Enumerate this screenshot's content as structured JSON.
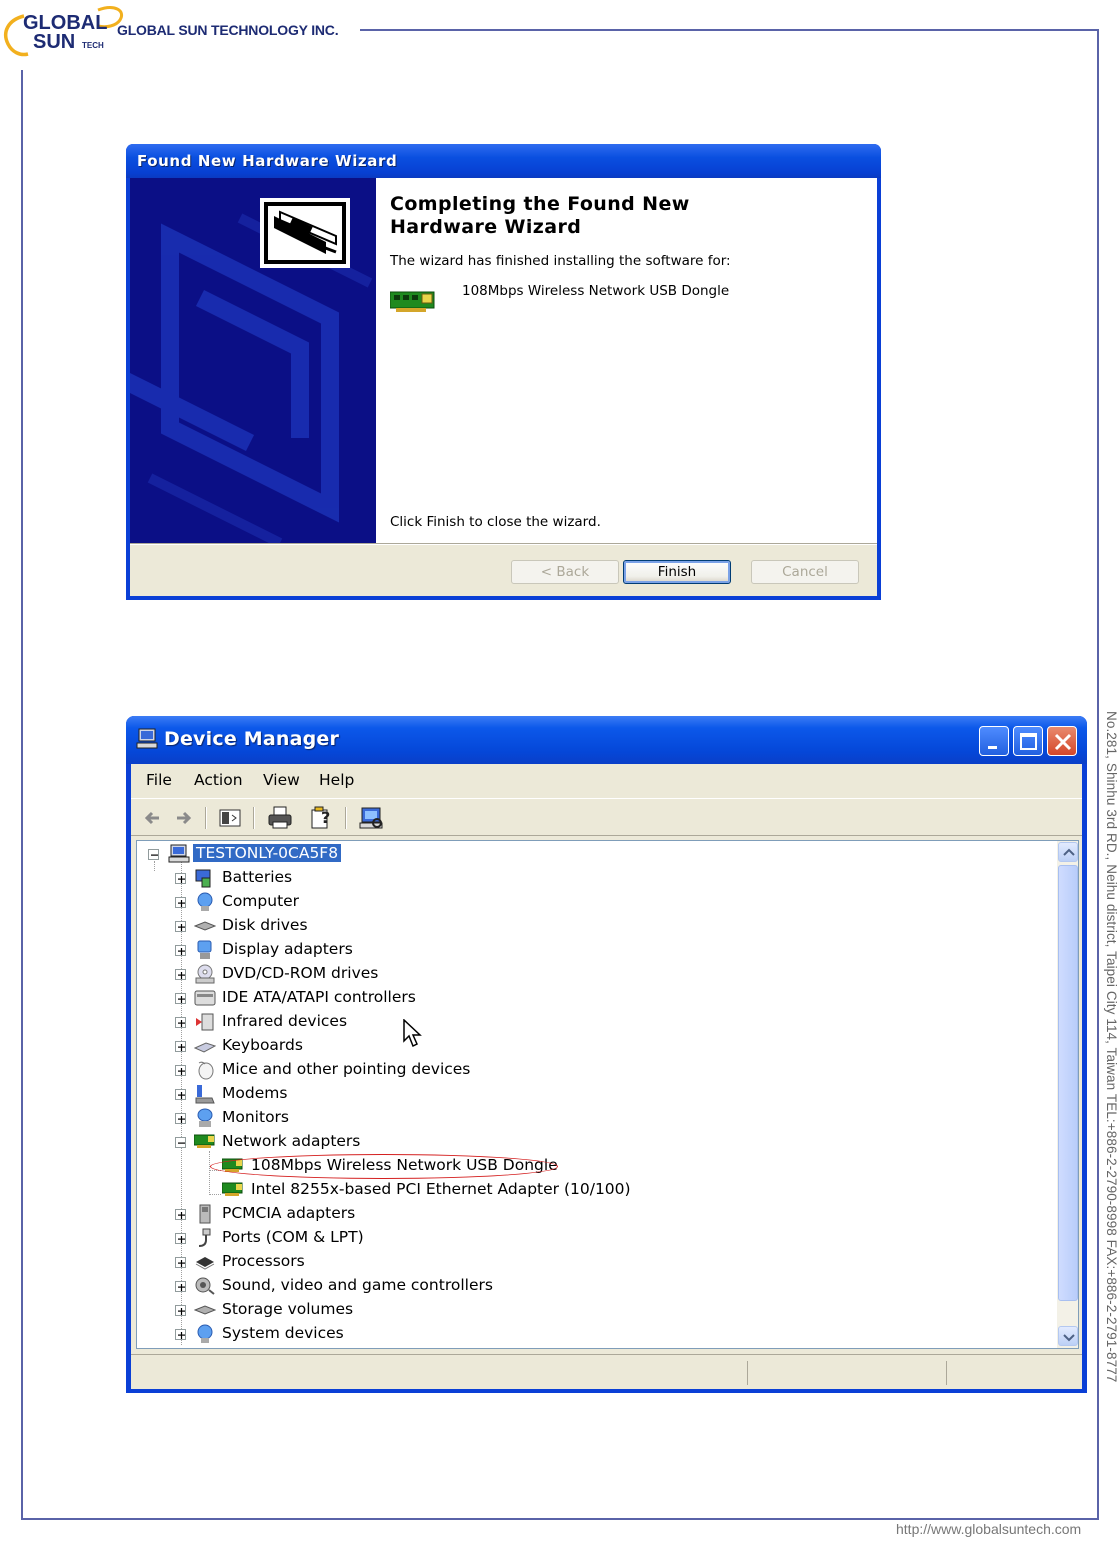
{
  "header": {
    "logo": {
      "line1": "GLOBAL",
      "line2": "SUN",
      "tag": "TECH"
    },
    "company": "GLOBAL SUN TECHNOLOGY INC."
  },
  "side_address": "No.281, Shinhu 3rd RD., Neihu district, Taipei City 114, Taiwan   TEL:+886-2-2790-8998   FAX:+886-2-2791-8777",
  "footer_url": "http://www.globalsuntech.com",
  "wizard": {
    "title": "Found New Hardware Wizard",
    "heading": "Completing the Found New Hardware Wizard",
    "installed_text": "The wizard has finished installing the software for:",
    "device_name": "108Mbps Wireless Network USB Dongle",
    "finish_text": "Click Finish to close the wizard.",
    "buttons": {
      "back": "< Back",
      "finish": "Finish",
      "cancel": "Cancel"
    }
  },
  "device_manager": {
    "title": "Device Manager",
    "menu": [
      "File",
      "Action",
      "View",
      "Help"
    ],
    "root": "TESTONLY-0CA5F8",
    "categories": [
      "Batteries",
      "Computer",
      "Disk drives",
      "Display adapters",
      "DVD/CD-ROM drives",
      "IDE ATA/ATAPI controllers",
      "Infrared devices",
      "Keyboards",
      "Mice and other pointing devices",
      "Modems",
      "Monitors",
      "Network adapters",
      "PCMCIA adapters",
      "Ports (COM & LPT)",
      "Processors",
      "Sound, video and game controllers",
      "Storage volumes",
      "System devices"
    ],
    "network_adapters": [
      "108Mbps Wireless Network USB Dongle",
      "Intel 8255x-based PCI Ethernet Adapter (10/100)"
    ]
  },
  "colors": {
    "title_blue": "#0a3fd6",
    "selection": "#316ac5",
    "highlight_ring": "#d42020",
    "frame": "#5a63a8"
  }
}
